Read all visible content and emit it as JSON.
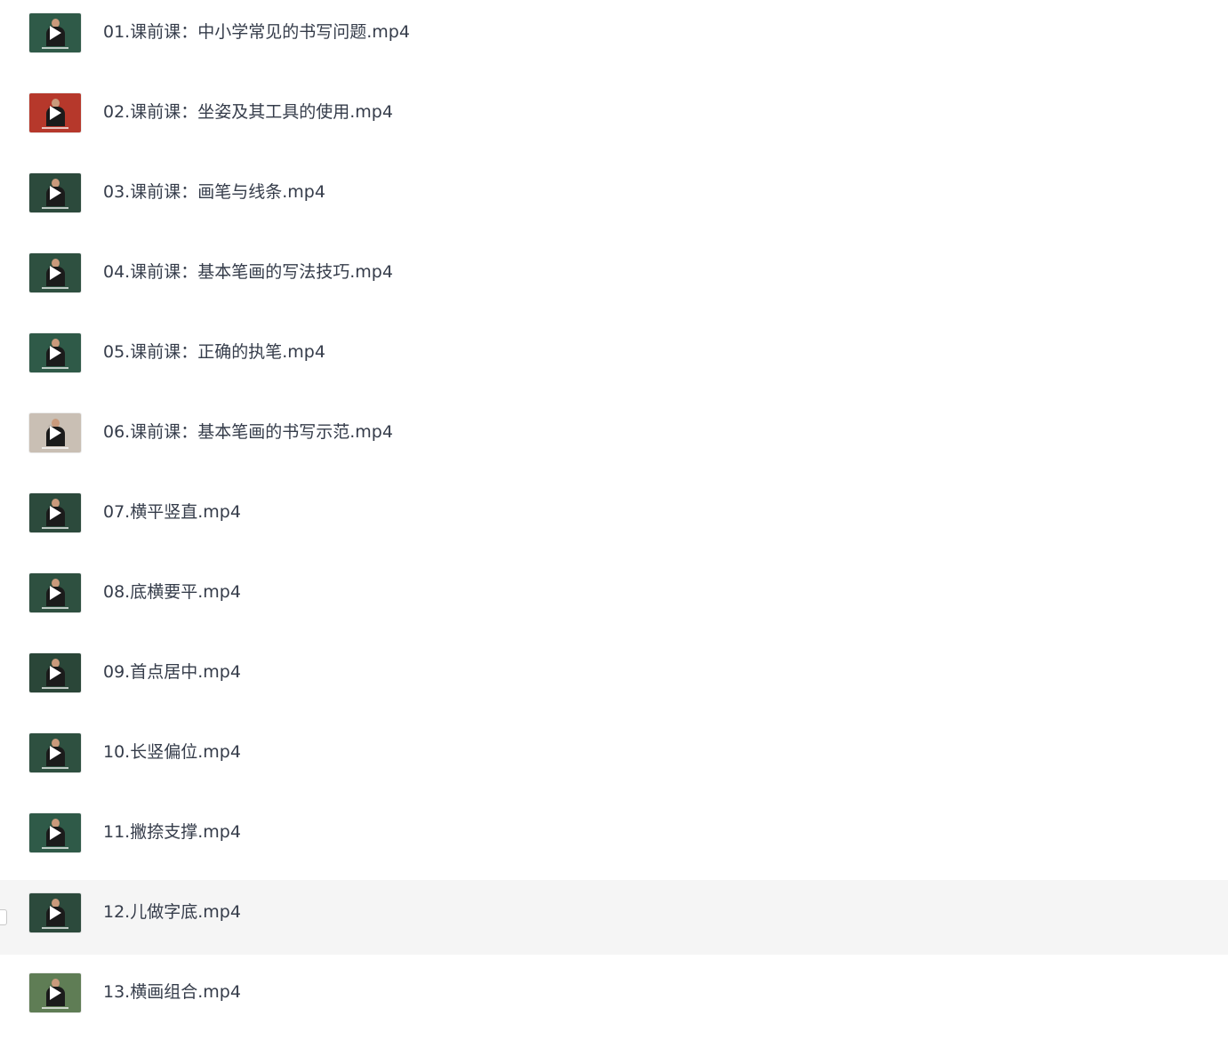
{
  "files": [
    {
      "name": "01.课前课：中小学常见的书写问题.mp4",
      "thumb_color": "#2f5a48"
    },
    {
      "name": "02.课前课：坐姿及其工具的使用.mp4",
      "thumb_color": "#b6382b"
    },
    {
      "name": "03.课前课：画笔与线条.mp4",
      "thumb_color": "#2c4a3c"
    },
    {
      "name": "04.课前课：基本笔画的写法技巧.mp4",
      "thumb_color": "#2e5040"
    },
    {
      "name": "05.课前课：正确的执笔.mp4",
      "thumb_color": "#2f5a48"
    },
    {
      "name": "06.课前课：基本笔画的书写示范.mp4",
      "thumb_color": "#c9bfb4"
    },
    {
      "name": "07.横平竖直.mp4",
      "thumb_color": "#2c4a3c"
    },
    {
      "name": "08.底横要平.mp4",
      "thumb_color": "#2e5040"
    },
    {
      "name": "09.首点居中.mp4",
      "thumb_color": "#2a4638"
    },
    {
      "name": "10.长竖偏位.mp4",
      "thumb_color": "#2e5040"
    },
    {
      "name": "11.撇捺支撑.mp4",
      "thumb_color": "#2f5a48"
    },
    {
      "name": "12.儿做字底.mp4",
      "thumb_color": "#2c4a3c",
      "selected": true
    },
    {
      "name": "13.横画组合.mp4",
      "thumb_color": "#5f7d55"
    }
  ],
  "play_icon": "play-icon"
}
